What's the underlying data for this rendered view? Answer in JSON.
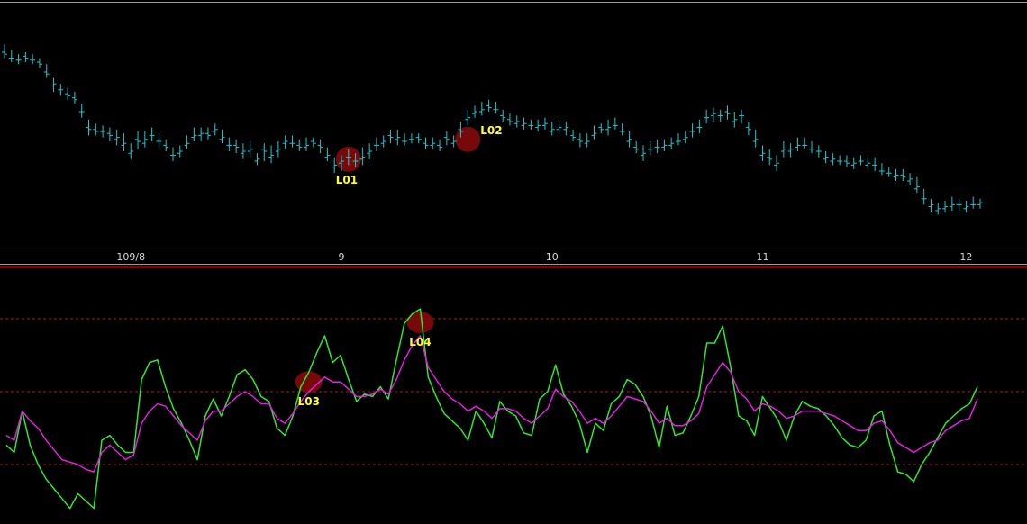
{
  "chart_data": [
    {
      "type": "ohlc",
      "panel": "price",
      "x_tick_labels": [
        {
          "label": "109/8",
          "bar_index": 18
        },
        {
          "label": "9",
          "bar_index": 48
        },
        {
          "label": "10",
          "bar_index": 78
        },
        {
          "label": "11",
          "bar_index": 108
        },
        {
          "label": "12",
          "bar_index": 137
        }
      ],
      "ylim": [
        0,
        100
      ],
      "bars": [
        [
          90,
          89,
          94,
          87
        ],
        [
          87,
          87,
          91,
          85
        ],
        [
          86,
          86,
          89,
          84
        ],
        [
          88,
          87,
          90,
          85
        ],
        [
          86,
          86,
          89,
          84
        ],
        [
          85,
          84,
          87,
          82
        ],
        [
          80,
          79,
          84,
          77
        ],
        [
          73,
          74,
          77,
          70
        ],
        [
          71,
          71,
          74,
          68
        ],
        [
          69,
          68,
          72,
          66
        ],
        [
          67,
          66,
          70,
          64
        ],
        [
          60,
          60,
          64,
          57
        ],
        [
          52,
          51,
          56,
          48
        ],
        [
          51,
          50,
          54,
          48
        ],
        [
          50,
          50,
          53,
          47
        ],
        [
          49,
          48,
          52,
          45
        ],
        [
          46,
          47,
          51,
          43
        ],
        [
          43,
          44,
          49,
          40
        ],
        [
          39,
          40,
          44,
          36
        ],
        [
          46,
          45,
          50,
          41
        ],
        [
          44,
          46,
          50,
          42
        ],
        [
          48,
          48,
          52,
          45
        ],
        [
          45,
          45,
          49,
          42
        ],
        [
          43,
          42,
          46,
          40
        ],
        [
          38,
          38,
          42,
          35
        ],
        [
          39,
          40,
          43,
          37
        ],
        [
          43,
          44,
          48,
          41
        ],
        [
          47,
          48,
          52,
          45
        ],
        [
          48,
          49,
          52,
          45
        ],
        [
          49,
          48,
          52,
          46
        ],
        [
          50,
          51,
          54,
          48
        ],
        [
          46,
          47,
          51,
          44
        ],
        [
          43,
          43,
          47,
          40
        ],
        [
          43,
          42,
          46,
          39
        ],
        [
          39,
          40,
          44,
          36
        ],
        [
          40,
          41,
          45,
          37
        ],
        [
          35,
          36,
          39,
          33
        ],
        [
          41,
          40,
          44,
          35
        ],
        [
          37,
          38,
          43,
          34
        ],
        [
          40,
          41,
          45,
          37
        ],
        [
          44,
          45,
          48,
          41
        ],
        [
          44,
          44,
          48,
          42
        ],
        [
          43,
          42,
          46,
          40
        ],
        [
          42,
          43,
          47,
          40
        ],
        [
          45,
          44,
          47,
          42
        ],
        [
          43,
          42,
          46,
          39
        ],
        [
          37,
          38,
          42,
          35
        ],
        [
          32,
          33,
          37,
          29
        ],
        [
          34,
          35,
          38,
          30
        ],
        [
          37,
          37,
          41,
          33
        ],
        [
          35,
          35,
          39,
          32
        ],
        [
          36,
          37,
          42,
          33
        ],
        [
          39,
          40,
          44,
          36
        ],
        [
          43,
          43,
          47,
          40
        ],
        [
          44,
          45,
          48,
          42
        ],
        [
          48,
          47,
          51,
          44
        ],
        [
          46,
          47,
          51,
          43
        ],
        [
          45,
          45,
          49,
          43
        ],
        [
          46,
          46,
          49,
          44
        ],
        [
          47,
          46,
          49,
          44
        ],
        [
          44,
          43,
          47,
          41
        ],
        [
          43,
          44,
          47,
          41
        ],
        [
          43,
          42,
          46,
          40
        ],
        [
          47,
          46,
          50,
          43
        ],
        [
          44,
          45,
          48,
          42
        ],
        [
          51,
          50,
          55,
          47
        ],
        [
          56,
          57,
          61,
          53
        ],
        [
          59,
          60,
          63,
          57
        ],
        [
          60,
          61,
          65,
          58
        ],
        [
          63,
          62,
          66,
          60
        ],
        [
          61,
          61,
          65,
          59
        ],
        [
          58,
          57,
          61,
          55
        ],
        [
          56,
          55,
          59,
          53
        ],
        [
          54,
          55,
          58,
          52
        ],
        [
          53,
          54,
          57,
          51
        ],
        [
          53,
          53,
          56,
          51
        ],
        [
          52,
          53,
          56,
          50
        ],
        [
          53,
          54,
          57,
          51
        ],
        [
          50,
          51,
          55,
          48
        ],
        [
          51,
          52,
          55,
          49
        ],
        [
          51,
          52,
          55,
          48
        ],
        [
          48,
          47,
          51,
          45
        ],
        [
          46,
          45,
          49,
          42
        ],
        [
          44,
          45,
          49,
          42
        ],
        [
          48,
          49,
          53,
          46
        ],
        [
          52,
          51,
          54,
          49
        ],
        [
          51,
          52,
          56,
          48
        ],
        [
          53,
          53,
          57,
          51
        ],
        [
          50,
          50,
          54,
          48
        ],
        [
          45,
          46,
          50,
          42
        ],
        [
          42,
          41,
          45,
          39
        ],
        [
          38,
          39,
          43,
          35
        ],
        [
          41,
          41,
          45,
          38
        ],
        [
          42,
          42,
          46,
          39
        ],
        [
          42,
          43,
          46,
          40
        ],
        [
          43,
          44,
          47,
          41
        ],
        [
          45,
          45,
          49,
          43
        ],
        [
          46,
          47,
          50,
          44
        ],
        [
          50,
          50,
          54,
          47
        ],
        [
          52,
          52,
          56,
          49
        ],
        [
          57,
          57,
          61,
          54
        ],
        [
          58,
          59,
          62,
          55
        ],
        [
          58,
          58,
          61,
          55
        ],
        [
          60,
          59,
          63,
          56
        ],
        [
          55,
          56,
          60,
          52
        ],
        [
          58,
          58,
          61,
          54
        ],
        [
          52,
          51,
          55,
          48
        ],
        [
          45,
          46,
          51,
          42
        ],
        [
          38,
          39,
          43,
          35
        ],
        [
          37,
          36,
          41,
          33
        ],
        [
          33,
          34,
          38,
          30
        ],
        [
          40,
          41,
          45,
          37
        ],
        [
          40,
          41,
          44,
          37
        ],
        [
          42,
          43,
          47,
          40
        ],
        [
          43,
          43,
          47,
          41
        ],
        [
          41,
          41,
          45,
          39
        ],
        [
          40,
          40,
          43,
          37
        ],
        [
          36,
          37,
          40,
          34
        ],
        [
          35,
          36,
          39,
          33
        ],
        [
          35,
          35,
          38,
          33
        ],
        [
          35,
          34,
          38,
          32
        ],
        [
          33,
          34,
          37,
          31
        ],
        [
          35,
          35,
          38,
          33
        ],
        [
          33,
          34,
          37,
          31
        ],
        [
          33,
          33,
          37,
          30
        ],
        [
          30,
          30,
          34,
          28
        ],
        [
          29,
          29,
          32,
          27
        ],
        [
          27,
          28,
          31,
          25
        ],
        [
          28,
          27,
          31,
          25
        ],
        [
          25,
          26,
          29,
          23
        ],
        [
          21,
          22,
          27,
          19
        ],
        [
          16,
          16,
          21,
          13
        ],
        [
          12,
          13,
          16,
          9
        ],
        [
          10,
          11,
          14,
          8
        ],
        [
          11,
          12,
          15,
          9
        ],
        [
          12,
          13,
          17,
          10
        ],
        [
          13,
          13,
          16,
          10
        ],
        [
          11,
          12,
          15,
          9
        ],
        [
          13,
          13,
          17,
          11
        ],
        [
          13,
          14,
          16,
          11
        ]
      ],
      "annotations": [
        {
          "label": "L01",
          "bar_index": 49,
          "value": 36
        },
        {
          "label": "L02",
          "bar_index": 66,
          "value": 46
        }
      ],
      "colors": {
        "bars": "#1fc9d0",
        "marker": "#8b0a0a",
        "annotation_text": "#ffff33"
      }
    },
    {
      "type": "line",
      "panel": "oscillator",
      "ylim": [
        0,
        100
      ],
      "reference_lines": [
        20,
        50,
        80
      ],
      "series": [
        {
          "color": "#2ee82e",
          "values": [
            28,
            25,
            42,
            28,
            20,
            14,
            10,
            6,
            2,
            8,
            5,
            2,
            30,
            32,
            28,
            25,
            25,
            55,
            62,
            63,
            52,
            43,
            37,
            30,
            22,
            40,
            47,
            40,
            48,
            57,
            59,
            55,
            48,
            46,
            35,
            32,
            40,
            52,
            58,
            66,
            73,
            62,
            65,
            55,
            46,
            49,
            48,
            52,
            47,
            63,
            78,
            82,
            84,
            56,
            48,
            41,
            38,
            35,
            30,
            42,
            37,
            31,
            46,
            42,
            40,
            33,
            32,
            47,
            50,
            61,
            49,
            44,
            37,
            25,
            37,
            34,
            45,
            48,
            55,
            53,
            48,
            40,
            27,
            44,
            32,
            33,
            40,
            48,
            70,
            70,
            77,
            60,
            40,
            38,
            32,
            48,
            43,
            38,
            30,
            40,
            46,
            44,
            43,
            40,
            36,
            31,
            28,
            27,
            30,
            40,
            42,
            28,
            17,
            16,
            13,
            20,
            25,
            31,
            37,
            40,
            43,
            45,
            52
          ]
        },
        {
          "color": "#e020e0",
          "values": [
            32,
            30,
            42,
            38,
            35,
            30,
            26,
            22,
            21,
            20,
            18,
            17,
            25,
            28,
            25,
            22,
            24,
            37,
            42,
            45,
            44,
            40,
            36,
            33,
            30,
            38,
            42,
            42,
            45,
            48,
            50,
            48,
            45,
            45,
            39,
            37,
            41,
            46,
            50,
            53,
            56,
            54,
            54,
            51,
            48,
            48,
            49,
            51,
            49,
            55,
            63,
            69,
            73,
            60,
            55,
            50,
            47,
            45,
            42,
            44,
            42,
            39,
            43,
            43,
            42,
            39,
            37,
            40,
            43,
            51,
            48,
            46,
            42,
            37,
            39,
            37,
            40,
            44,
            48,
            47,
            46,
            42,
            37,
            39,
            36,
            36,
            38,
            41,
            52,
            57,
            62,
            58,
            50,
            47,
            42,
            45,
            44,
            42,
            39,
            40,
            42,
            42,
            42,
            41,
            40,
            38,
            36,
            34,
            34,
            37,
            38,
            34,
            29,
            27,
            25,
            27,
            29,
            30,
            34,
            36,
            38,
            39,
            47
          ]
        }
      ],
      "annotations": [
        {
          "label": "L03",
          "point_index": 38
        },
        {
          "label": "L04",
          "point_index": 52
        }
      ]
    }
  ]
}
